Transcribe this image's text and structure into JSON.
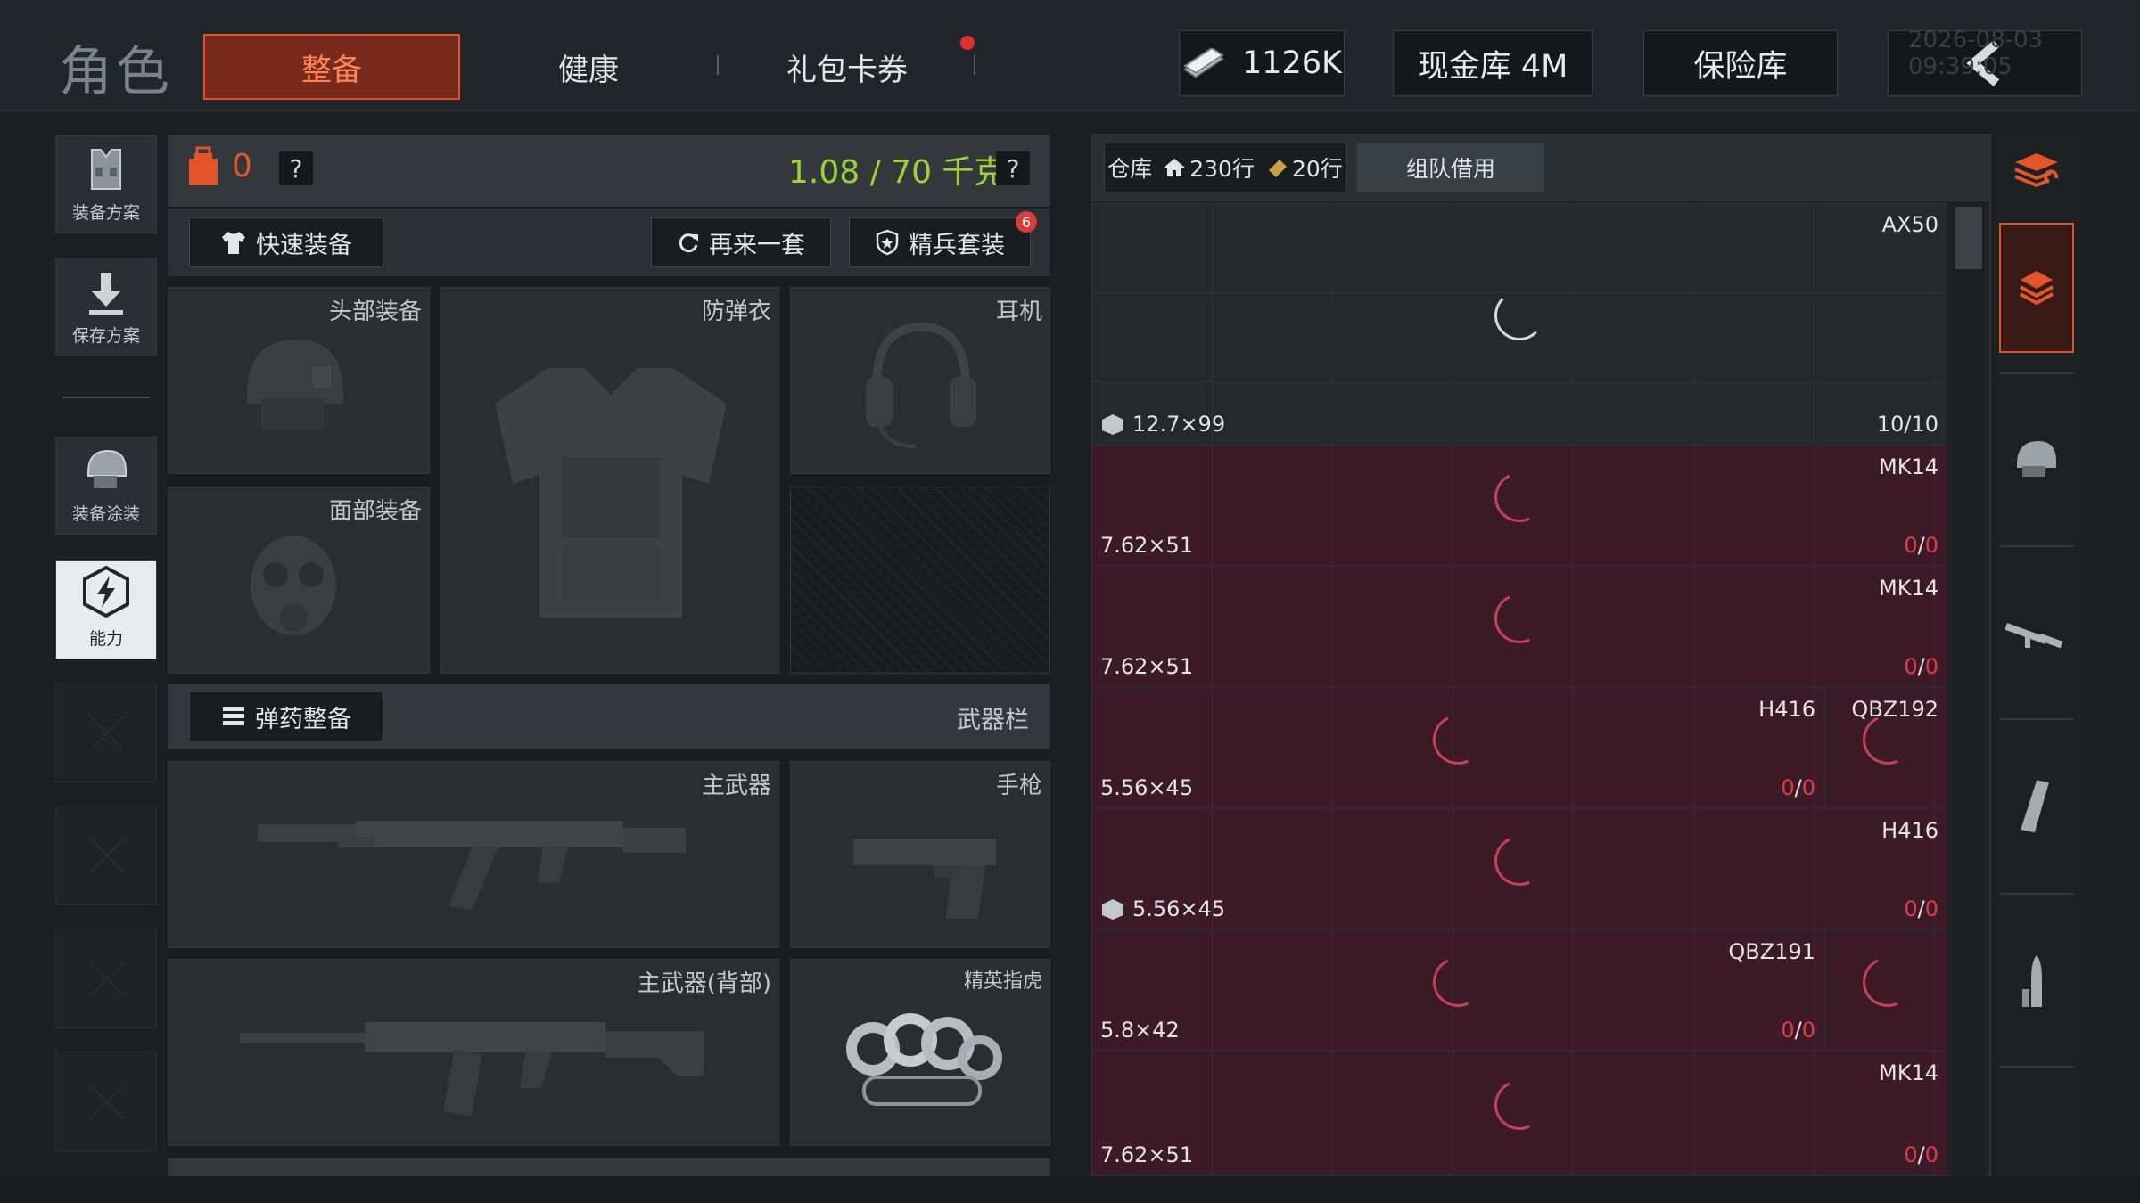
{
  "header": {
    "title": "角色",
    "tabs": [
      {
        "label": "整备",
        "active": true
      },
      {
        "label": "健康",
        "active": false
      },
      {
        "label": "礼包卡券",
        "active": false
      }
    ],
    "currency_amount": "1126K",
    "cash_vault_label": "现金库 4M",
    "safe_label": "保险库",
    "timestamp": "2026-08-03 09:39:05"
  },
  "sidebar": {
    "items": [
      {
        "label": "装备方案",
        "icon": "vest-plan-icon"
      },
      {
        "label": "保存方案",
        "icon": "download-icon"
      },
      {
        "label": "装备涂装",
        "icon": "helmet-paint-icon"
      },
      {
        "label": "能力",
        "icon": "ability-icon",
        "active": true
      }
    ]
  },
  "loadout": {
    "backpack_count": "0",
    "weight": "1.08 / 70 千克",
    "help_glyph": "?",
    "quick_equip_label": "快速装备",
    "reroll_label": "再来一套",
    "elite_set_label": "精兵套装",
    "elite_badge": "6",
    "slots": {
      "head": "头部装备",
      "armor": "防弹衣",
      "headset": "耳机",
      "face": "面部装备",
      "primary": "主武器",
      "pistol": "手枪",
      "primary_back": "主武器(背部)",
      "melee": "精英指虎"
    },
    "ammo_label": "弹药整备",
    "weapon_bar_label": "武器栏"
  },
  "warehouse": {
    "tab_label": "仓库",
    "home_rows": "230行",
    "ticket_rows": "20行",
    "team_borrow_label": "组队借用",
    "rows": [
      {
        "status": "ok",
        "cells": [
          {
            "weapon": "AX50"
          }
        ],
        "caliber": "12.7×99",
        "count": "10/10",
        "box": true
      },
      {
        "status": "bad",
        "cells": [
          {
            "weapon": "MK14"
          }
        ],
        "caliber": "7.62×51",
        "count_have": "0",
        "count_total": "0",
        "box": false
      },
      {
        "status": "bad",
        "cells": [
          {
            "weapon": "MK14"
          }
        ],
        "caliber": "7.62×51",
        "count_have": "0",
        "count_total": "0",
        "box": false
      },
      {
        "status": "bad",
        "cells": [
          {
            "weapon": "H416"
          },
          {
            "weapon": "QBZ192"
          }
        ],
        "caliber": "5.56×45",
        "count_have": "0",
        "count_total": "0",
        "box": false
      },
      {
        "status": "bad",
        "cells": [
          {
            "weapon": "H416"
          }
        ],
        "caliber": "5.56×45",
        "count_have": "0",
        "count_total": "0",
        "box": true
      },
      {
        "status": "bad",
        "cells": [
          {
            "weapon": "QBZ191"
          },
          {
            "weapon": ""
          }
        ],
        "caliber": "5.8×42",
        "count_have": "0",
        "count_total": "0",
        "box": false
      },
      {
        "status": "bad",
        "cells": [
          {
            "weapon": "MK14"
          }
        ],
        "caliber": "7.62×51",
        "count_have": "0",
        "count_total": "0",
        "box": false
      }
    ]
  },
  "filters": [
    "stack-filter-icon",
    "ammo-box-filter-icon",
    "helmet-filter-icon",
    "rifle-filter-icon",
    "magazine-filter-icon",
    "bullet-filter-icon"
  ],
  "colors": {
    "accent": "#d8552e",
    "weight": "#9bd23a",
    "alert": "#e03a4c",
    "missing_row": "#3c1b26"
  }
}
